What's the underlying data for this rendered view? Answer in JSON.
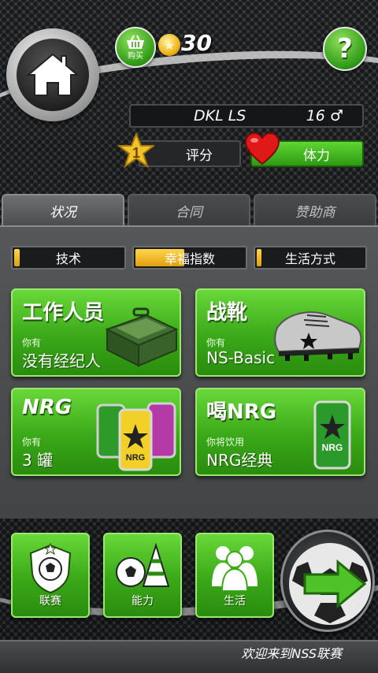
{
  "top": {
    "shop_label": "购买",
    "coins": "30",
    "help_label": "?"
  },
  "player": {
    "name": "DKL LS",
    "age": "16",
    "gender_symbol": "♂",
    "level": "1",
    "rating_label": "评分",
    "energy_label": "体力"
  },
  "tabs": [
    {
      "label": "状况",
      "active": true
    },
    {
      "label": "合同",
      "active": false
    },
    {
      "label": "赞助商",
      "active": false
    }
  ],
  "subtabs": [
    {
      "label": "技术",
      "fill_percent": 6
    },
    {
      "label": "幸福指数",
      "fill_percent": 45
    },
    {
      "label": "生活方式",
      "fill_percent": 6
    }
  ],
  "cards": {
    "staff": {
      "title": "工作人员",
      "sub": "你有",
      "value": "没有经纪人"
    },
    "boots": {
      "title": "战靴",
      "sub": "你有",
      "value": "NS-Basic"
    },
    "nrg": {
      "title": "NRG",
      "sub": "你有",
      "value": "3 罐"
    },
    "drink": {
      "title": "喝NRG",
      "sub": "你将饮用",
      "value": "NRG经典"
    }
  },
  "nav": {
    "league_label": "联赛",
    "ability_label": "能力",
    "life_label": "生活"
  },
  "footer": {
    "welcome": "欢迎来到NSS联赛"
  },
  "colors": {
    "green": "#3aa818",
    "yellow": "#f0b41c",
    "dark": "#2b2d2f"
  }
}
